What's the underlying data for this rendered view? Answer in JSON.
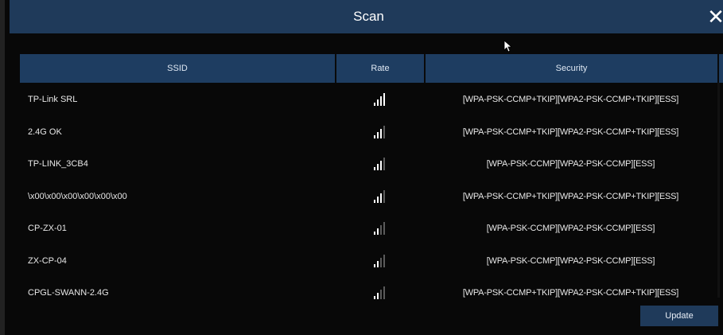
{
  "window": {
    "title": "Scan"
  },
  "table": {
    "headers": {
      "ssid": "SSID",
      "rate": "Rate",
      "security": "Security"
    },
    "rows": [
      {
        "ssid": "TP-Link SRL",
        "signal_bars": 4,
        "security": "[WPA-PSK-CCMP+TKIP][WPA2-PSK-CCMP+TKIP][ESS]"
      },
      {
        "ssid": "2.4G OK",
        "signal_bars": 3,
        "security": "[WPA-PSK-CCMP+TKIP][WPA2-PSK-CCMP+TKIP][ESS]"
      },
      {
        "ssid": "TP-LINK_3CB4",
        "signal_bars": 3,
        "security": "[WPA-PSK-CCMP][WPA2-PSK-CCMP][ESS]"
      },
      {
        "ssid": "\\x00\\x00\\x00\\x00\\x00\\x00",
        "signal_bars": 3,
        "security": "[WPA-PSK-CCMP+TKIP][WPA2-PSK-CCMP+TKIP][ESS]"
      },
      {
        "ssid": "CP-ZX-01",
        "signal_bars": 2,
        "security": "[WPA-PSK-CCMP][WPA2-PSK-CCMP][ESS]"
      },
      {
        "ssid": "ZX-CP-04",
        "signal_bars": 2,
        "security": "[WPA-PSK-CCMP][WPA2-PSK-CCMP][ESS]"
      },
      {
        "ssid": "CPGL-SWANN-2.4G",
        "signal_bars": 2,
        "security": "[WPA-PSK-CCMP+TKIP][WPA2-PSK-CCMP+TKIP][ESS]"
      }
    ]
  },
  "buttons": {
    "update_label": "Update",
    "close_icon": "close-icon"
  },
  "colors": {
    "title_bar": "#1f3a5a",
    "header_row": "#1e3d61",
    "background": "#080808",
    "button": "#1f3a5a"
  }
}
